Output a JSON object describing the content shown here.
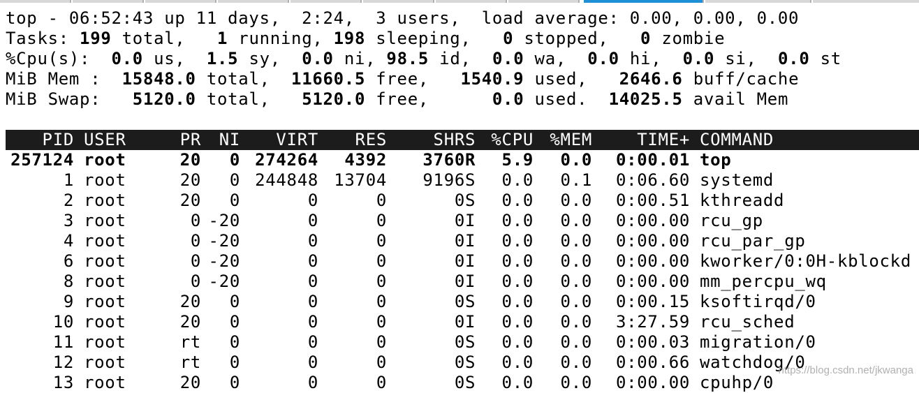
{
  "summary": {
    "uptime": "top - 06:52:43 up 11 days,  2:24,  3 users,  load average: 0.00, 0.00, 0.00",
    "tasks": {
      "label": "Tasks: ",
      "total": "199",
      "total_t": " total,   ",
      "running": "1",
      "running_t": " running, ",
      "sleeping": "198",
      "sleeping_t": " sleeping,   ",
      "stopped": "0",
      "stopped_t": " stopped,   ",
      "zombie": "0",
      "zombie_t": " zombie"
    },
    "cpu": {
      "label": "%Cpu(s):  ",
      "us": "0.0",
      "us_t": " us,  ",
      "sy": "1.5",
      "sy_t": " sy,  ",
      "ni": "0.0",
      "ni_t": " ni, ",
      "id": "98.5",
      "id_t": " id,  ",
      "wa": "0.0",
      "wa_t": " wa,  ",
      "hi": "0.0",
      "hi_t": " hi,  ",
      "si": "0.0",
      "si_t": " si,  ",
      "st": "0.0",
      "st_t": " st"
    },
    "mem": {
      "label": "MiB Mem :  ",
      "total": "15848.0",
      "total_t": " total,  ",
      "free": "11660.5",
      "free_t": " free,   ",
      "used": "1540.9",
      "used_t": " used,   ",
      "buff": "2646.6",
      "buff_t": " buff/cache"
    },
    "swap": {
      "label": "MiB Swap:   ",
      "total": "5120.0",
      "total_t": " total,   ",
      "free": "5120.0",
      "free_t": " free,      ",
      "used": "0.0",
      "used_t": " used.  ",
      "avail": "14025.5",
      "avail_t": " avail Mem"
    }
  },
  "columns": [
    "PID",
    "USER",
    "PR",
    "NI",
    "VIRT",
    "RES",
    "SHR",
    "S",
    "%CPU",
    "%MEM",
    "TIME+",
    "COMMAND"
  ],
  "processes": [
    [
      "257124",
      "root",
      "20",
      "0",
      "274264",
      "4392",
      "3760",
      "R",
      "5.9",
      "0.0",
      "0:00.01",
      "top"
    ],
    [
      "1",
      "root",
      "20",
      "0",
      "244848",
      "13704",
      "9196",
      "S",
      "0.0",
      "0.1",
      "0:06.60",
      "systemd"
    ],
    [
      "2",
      "root",
      "20",
      "0",
      "0",
      "0",
      "0",
      "S",
      "0.0",
      "0.0",
      "0:00.51",
      "kthreadd"
    ],
    [
      "3",
      "root",
      "0",
      "-20",
      "0",
      "0",
      "0",
      "I",
      "0.0",
      "0.0",
      "0:00.00",
      "rcu_gp"
    ],
    [
      "4",
      "root",
      "0",
      "-20",
      "0",
      "0",
      "0",
      "I",
      "0.0",
      "0.0",
      "0:00.00",
      "rcu_par_gp"
    ],
    [
      "6",
      "root",
      "0",
      "-20",
      "0",
      "0",
      "0",
      "I",
      "0.0",
      "0.0",
      "0:00.00",
      "kworker/0:0H-kblockd"
    ],
    [
      "8",
      "root",
      "0",
      "-20",
      "0",
      "0",
      "0",
      "I",
      "0.0",
      "0.0",
      "0:00.00",
      "mm_percpu_wq"
    ],
    [
      "9",
      "root",
      "20",
      "0",
      "0",
      "0",
      "0",
      "S",
      "0.0",
      "0.0",
      "0:00.15",
      "ksoftirqd/0"
    ],
    [
      "10",
      "root",
      "20",
      "0",
      "0",
      "0",
      "0",
      "I",
      "0.0",
      "0.0",
      "3:27.59",
      "rcu_sched"
    ],
    [
      "11",
      "root",
      "rt",
      "0",
      "0",
      "0",
      "0",
      "S",
      "0.0",
      "0.0",
      "0:00.03",
      "migration/0"
    ],
    [
      "12",
      "root",
      "rt",
      "0",
      "0",
      "0",
      "0",
      "S",
      "0.0",
      "0.0",
      "0:00.66",
      "watchdog/0"
    ],
    [
      "13",
      "root",
      "20",
      "0",
      "0",
      "0",
      "0",
      "S",
      "0.0",
      "0.0",
      "0:00.00",
      "cpuhp/0"
    ]
  ],
  "watermark": "https://blog.csdn.net/jkwanga",
  "colors": {
    "header_bg": "#1c1c1c",
    "header_fg": "#ffffff",
    "active_tab": "#1e90d6"
  }
}
